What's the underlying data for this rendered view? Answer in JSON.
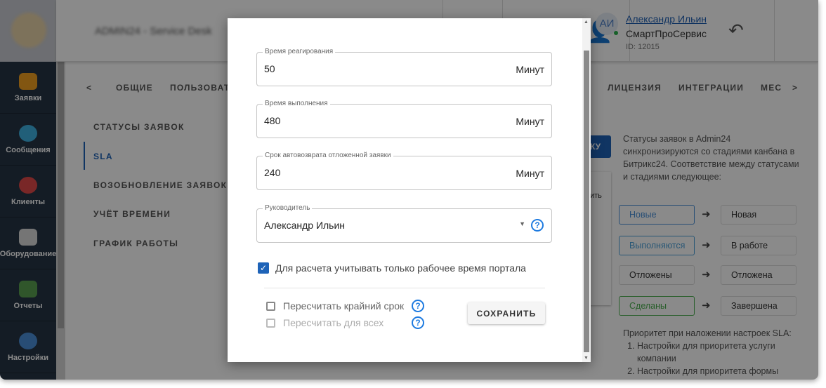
{
  "header": {
    "brand": "ADMIN24 - Service Desk",
    "user": {
      "initials": "АИ",
      "name": "Александр Ильин",
      "company": "СмартПроСервис",
      "id": "ID: 12015"
    }
  },
  "sidebar": {
    "items": [
      {
        "label": "Заявки",
        "color": "#f0a020"
      },
      {
        "label": "Сообщения",
        "color": "#3db0e0"
      },
      {
        "label": "Клиенты",
        "color": "#e04848"
      },
      {
        "label": "Оборудование",
        "color": "#d8d8d8"
      },
      {
        "label": "Отчеты",
        "color": "#5aa050"
      },
      {
        "label": "Настройки",
        "color": "#4a8fd8"
      }
    ]
  },
  "tabs": {
    "items": [
      "ОБЩИЕ",
      "ПОЛЬЗОВАТ",
      "ЛИЦЕНЗИЯ",
      "ИНТЕГРАЦИИ",
      "МЕС"
    ]
  },
  "submenu": {
    "items": [
      "СТАТУСЫ ЗАЯВОК",
      "SLA",
      "ВОЗОБНОВЛЕНИЕ ЗАЯВОК",
      "УЧЁТ ВРЕМЕНИ",
      "ГРАФИК РАБОТЫ"
    ],
    "active": "SLA"
  },
  "background": {
    "button_fragment": "КУ",
    "card_fragment": "ить",
    "info": "Статусы заявок в Admin24 синхронизируются со стадиями канбана в Битрикс24. Соответствие между статусами и стадиями следующее:",
    "mapping": [
      {
        "status": "Новые",
        "stage": "Новая",
        "color": "#4a90d9"
      },
      {
        "status": "Выполняются",
        "stage": "В работе",
        "color": "#4aa0d9"
      },
      {
        "status": "Отложены",
        "stage": "Отложена",
        "color": "#333333"
      },
      {
        "status": "Сделаны",
        "stage": "Завершена",
        "color": "#4caf50"
      }
    ],
    "priority_title": "Приоритет при наложении настроек SLA:",
    "priority_items": [
      "Настройки для приоритета услуги компании",
      "Настройки для приоритета формы"
    ]
  },
  "modal": {
    "reaction": {
      "label": "Время реагирования",
      "value": "50",
      "unit": "Минут"
    },
    "execution": {
      "label": "Время выполнения",
      "value": "480",
      "unit": "Минут"
    },
    "autoreturn": {
      "label": "Срок автовозврата отложенной заявки",
      "value": "240",
      "unit": "Минут"
    },
    "manager": {
      "label": "Руководитель",
      "value": "Александр Ильин"
    },
    "work_time_checkbox": {
      "label": "Для расчета учитывать только рабочее время портала",
      "checked": true
    },
    "recalc_deadline": {
      "label": "Пересчитать крайний срок",
      "checked": false
    },
    "recalc_all": {
      "label": "Пересчитать для всех",
      "checked": false,
      "disabled": true
    },
    "save_label": "СОХРАНИТЬ"
  }
}
